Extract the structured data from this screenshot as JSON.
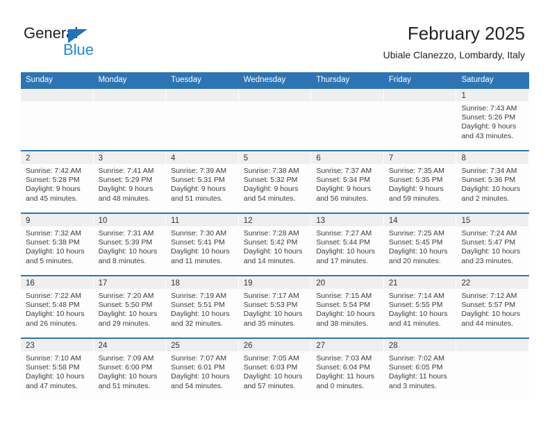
{
  "brand": {
    "name_part1": "General",
    "name_part2": "Blue",
    "triangle_color": "#1f72bd",
    "blue_text_color": "#1f8ae0"
  },
  "header": {
    "title": "February 2025",
    "location": "Ubiale Clanezzo, Lombardy, Italy"
  },
  "theme": {
    "header_blue": "#2e74b5",
    "day_band_gray": "#efefef",
    "cell_background": "#fdfdfd"
  },
  "weekdays": [
    "Sunday",
    "Monday",
    "Tuesday",
    "Wednesday",
    "Thursday",
    "Friday",
    "Saturday"
  ],
  "weeks": [
    [
      {
        "day": "",
        "l1": "",
        "l2": "",
        "l3": "",
        "l4": ""
      },
      {
        "day": "",
        "l1": "",
        "l2": "",
        "l3": "",
        "l4": ""
      },
      {
        "day": "",
        "l1": "",
        "l2": "",
        "l3": "",
        "l4": ""
      },
      {
        "day": "",
        "l1": "",
        "l2": "",
        "l3": "",
        "l4": ""
      },
      {
        "day": "",
        "l1": "",
        "l2": "",
        "l3": "",
        "l4": ""
      },
      {
        "day": "",
        "l1": "",
        "l2": "",
        "l3": "",
        "l4": ""
      },
      {
        "day": "1",
        "l1": "Sunrise: 7:43 AM",
        "l2": "Sunset: 5:26 PM",
        "l3": "Daylight: 9 hours",
        "l4": "and 43 minutes."
      }
    ],
    [
      {
        "day": "2",
        "l1": "Sunrise: 7:42 AM",
        "l2": "Sunset: 5:28 PM",
        "l3": "Daylight: 9 hours",
        "l4": "and 45 minutes."
      },
      {
        "day": "3",
        "l1": "Sunrise: 7:41 AM",
        "l2": "Sunset: 5:29 PM",
        "l3": "Daylight: 9 hours",
        "l4": "and 48 minutes."
      },
      {
        "day": "4",
        "l1": "Sunrise: 7:39 AM",
        "l2": "Sunset: 5:31 PM",
        "l3": "Daylight: 9 hours",
        "l4": "and 51 minutes."
      },
      {
        "day": "5",
        "l1": "Sunrise: 7:38 AM",
        "l2": "Sunset: 5:32 PM",
        "l3": "Daylight: 9 hours",
        "l4": "and 54 minutes."
      },
      {
        "day": "6",
        "l1": "Sunrise: 7:37 AM",
        "l2": "Sunset: 5:34 PM",
        "l3": "Daylight: 9 hours",
        "l4": "and 56 minutes."
      },
      {
        "day": "7",
        "l1": "Sunrise: 7:35 AM",
        "l2": "Sunset: 5:35 PM",
        "l3": "Daylight: 9 hours",
        "l4": "and 59 minutes."
      },
      {
        "day": "8",
        "l1": "Sunrise: 7:34 AM",
        "l2": "Sunset: 5:36 PM",
        "l3": "Daylight: 10 hours",
        "l4": "and 2 minutes."
      }
    ],
    [
      {
        "day": "9",
        "l1": "Sunrise: 7:32 AM",
        "l2": "Sunset: 5:38 PM",
        "l3": "Daylight: 10 hours",
        "l4": "and 5 minutes."
      },
      {
        "day": "10",
        "l1": "Sunrise: 7:31 AM",
        "l2": "Sunset: 5:39 PM",
        "l3": "Daylight: 10 hours",
        "l4": "and 8 minutes."
      },
      {
        "day": "11",
        "l1": "Sunrise: 7:30 AM",
        "l2": "Sunset: 5:41 PM",
        "l3": "Daylight: 10 hours",
        "l4": "and 11 minutes."
      },
      {
        "day": "12",
        "l1": "Sunrise: 7:28 AM",
        "l2": "Sunset: 5:42 PM",
        "l3": "Daylight: 10 hours",
        "l4": "and 14 minutes."
      },
      {
        "day": "13",
        "l1": "Sunrise: 7:27 AM",
        "l2": "Sunset: 5:44 PM",
        "l3": "Daylight: 10 hours",
        "l4": "and 17 minutes."
      },
      {
        "day": "14",
        "l1": "Sunrise: 7:25 AM",
        "l2": "Sunset: 5:45 PM",
        "l3": "Daylight: 10 hours",
        "l4": "and 20 minutes."
      },
      {
        "day": "15",
        "l1": "Sunrise: 7:24 AM",
        "l2": "Sunset: 5:47 PM",
        "l3": "Daylight: 10 hours",
        "l4": "and 23 minutes."
      }
    ],
    [
      {
        "day": "16",
        "l1": "Sunrise: 7:22 AM",
        "l2": "Sunset: 5:48 PM",
        "l3": "Daylight: 10 hours",
        "l4": "and 26 minutes."
      },
      {
        "day": "17",
        "l1": "Sunrise: 7:20 AM",
        "l2": "Sunset: 5:50 PM",
        "l3": "Daylight: 10 hours",
        "l4": "and 29 minutes."
      },
      {
        "day": "18",
        "l1": "Sunrise: 7:19 AM",
        "l2": "Sunset: 5:51 PM",
        "l3": "Daylight: 10 hours",
        "l4": "and 32 minutes."
      },
      {
        "day": "19",
        "l1": "Sunrise: 7:17 AM",
        "l2": "Sunset: 5:53 PM",
        "l3": "Daylight: 10 hours",
        "l4": "and 35 minutes."
      },
      {
        "day": "20",
        "l1": "Sunrise: 7:15 AM",
        "l2": "Sunset: 5:54 PM",
        "l3": "Daylight: 10 hours",
        "l4": "and 38 minutes."
      },
      {
        "day": "21",
        "l1": "Sunrise: 7:14 AM",
        "l2": "Sunset: 5:55 PM",
        "l3": "Daylight: 10 hours",
        "l4": "and 41 minutes."
      },
      {
        "day": "22",
        "l1": "Sunrise: 7:12 AM",
        "l2": "Sunset: 5:57 PM",
        "l3": "Daylight: 10 hours",
        "l4": "and 44 minutes."
      }
    ],
    [
      {
        "day": "23",
        "l1": "Sunrise: 7:10 AM",
        "l2": "Sunset: 5:58 PM",
        "l3": "Daylight: 10 hours",
        "l4": "and 47 minutes."
      },
      {
        "day": "24",
        "l1": "Sunrise: 7:09 AM",
        "l2": "Sunset: 6:00 PM",
        "l3": "Daylight: 10 hours",
        "l4": "and 51 minutes."
      },
      {
        "day": "25",
        "l1": "Sunrise: 7:07 AM",
        "l2": "Sunset: 6:01 PM",
        "l3": "Daylight: 10 hours",
        "l4": "and 54 minutes."
      },
      {
        "day": "26",
        "l1": "Sunrise: 7:05 AM",
        "l2": "Sunset: 6:03 PM",
        "l3": "Daylight: 10 hours",
        "l4": "and 57 minutes."
      },
      {
        "day": "27",
        "l1": "Sunrise: 7:03 AM",
        "l2": "Sunset: 6:04 PM",
        "l3": "Daylight: 11 hours",
        "l4": "and 0 minutes."
      },
      {
        "day": "28",
        "l1": "Sunrise: 7:02 AM",
        "l2": "Sunset: 6:05 PM",
        "l3": "Daylight: 11 hours",
        "l4": "and 3 minutes."
      },
      {
        "day": "",
        "l1": "",
        "l2": "",
        "l3": "",
        "l4": ""
      }
    ]
  ]
}
